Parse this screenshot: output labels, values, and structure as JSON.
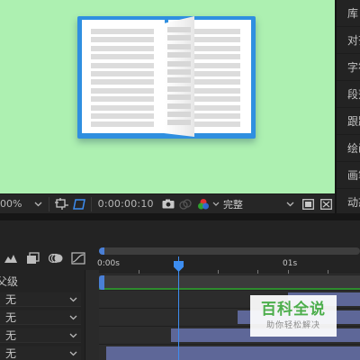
{
  "viewer": {
    "zoom": "00%",
    "timecode": "0:00:00:10",
    "quality": "完整",
    "background_color": "#adf0b1",
    "icons": [
      "chevron-down-icon",
      "region-of-interest-icon",
      "transparency-grid-icon",
      "camera-icon",
      "show-snapshot-icon",
      "color-channels-icon",
      "chevron-down-icon",
      "view-layout-icon",
      "fast-preview-icon"
    ]
  },
  "right_panel": {
    "items": [
      "库",
      "对齐",
      "字符",
      "段落",
      "跟踪器",
      "绘画",
      "画笔",
      "动态草图"
    ]
  },
  "timeline": {
    "tools": [
      "comp-mini-flowchart-icon",
      "draft-3d-icon",
      "motion-blur-icon",
      "graph-editor-icon"
    ],
    "column_header": "父级",
    "rows": [
      {
        "value": "无"
      },
      {
        "value": "无"
      },
      {
        "value": "无"
      },
      {
        "value": "无"
      }
    ],
    "ruler": {
      "start": "0:00s",
      "mark": "01s"
    },
    "playhead_color": "#3d8df0",
    "layer_color": "#5e6798"
  },
  "watermark": {
    "title": "百科全说",
    "subtitle": "助你轻松解决"
  }
}
